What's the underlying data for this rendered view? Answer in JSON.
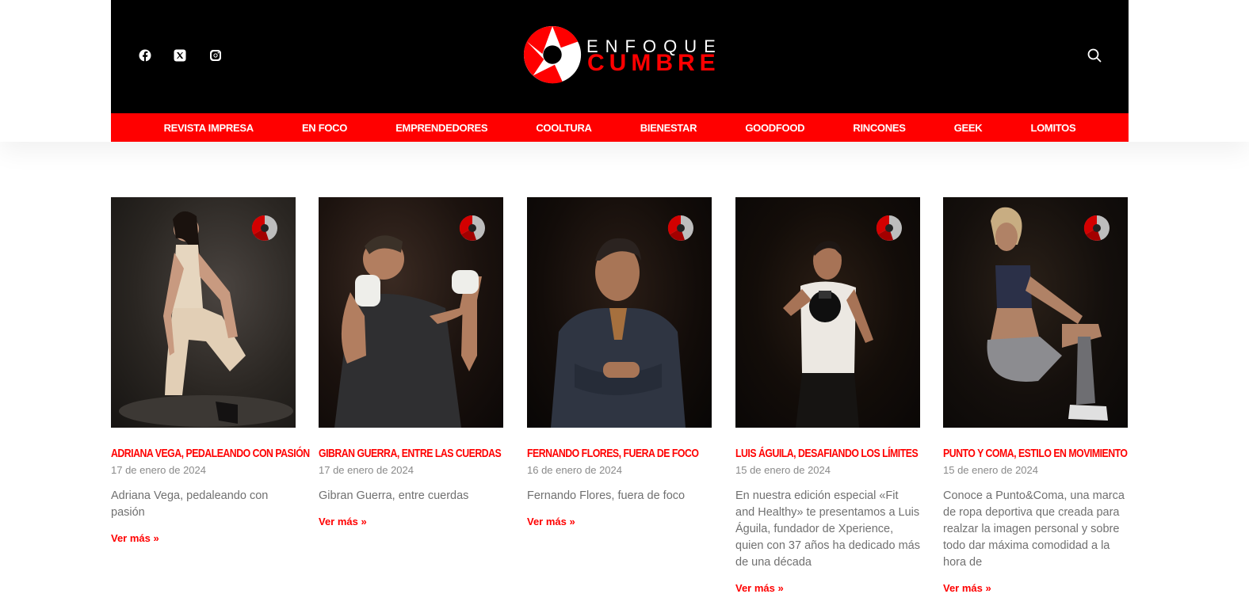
{
  "brand": {
    "line1": "ENFOQUE",
    "line2": "CUMBRE",
    "accent": "#ff0000",
    "header_bg": "#000000"
  },
  "social_icons": [
    "facebook-icon",
    "x-icon",
    "instagram-icon"
  ],
  "nav": [
    "REVISTA IMPRESA",
    "EN FOCO",
    "EMPRENDEDORES",
    "COOLTURA",
    "BIENESTAR",
    "GOODFOOD",
    "RINCONES",
    "GEEK",
    "LOMITOS"
  ],
  "posts": [
    {
      "title": "Adriana Vega, pedaleando con pasión",
      "date": "17 de enero de 2024",
      "excerpt": "Adriana Vega, pedaleando con pasión",
      "more": "Ver más »"
    },
    {
      "title": "Gibran Guerra, entre las cuerdas",
      "date": "17 de enero de 2024",
      "excerpt": "Gibran Guerra, entre cuerdas",
      "more": "Ver más »"
    },
    {
      "title": "Fernando Flores, fuera de foco",
      "date": "16 de enero de 2024",
      "excerpt": "Fernando Flores, fuera de foco",
      "more": "Ver más »"
    },
    {
      "title": "Luis Águila, desafiando los límites",
      "date": "15 de enero de 2024",
      "excerpt": "En nuestra edición especial «Fit and Healthy» te presentamos a Luis Águila, fundador de Xperience, quien con 37 años ha dedicado más de una década",
      "more": "Ver más »"
    },
    {
      "title": "Punto y coma, estilo en movimiento",
      "date": "15 de enero de 2024",
      "excerpt": "Conoce a Punto&Coma, una marca de ropa deportiva que creada para realzar la imagen personal y sobre todo dar máxima comodidad a la hora de",
      "more": "Ver más »"
    }
  ]
}
